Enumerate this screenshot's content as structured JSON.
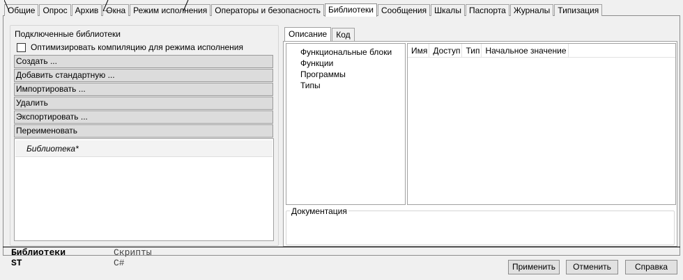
{
  "top_tabs": [
    "Общие",
    "Опрос",
    "Архив",
    "Окна",
    "Режим исполнения",
    "Операторы и безопасность",
    "Библиотеки",
    "Сообщения",
    "Шкалы",
    "Паспорта",
    "Журналы",
    "Типизация"
  ],
  "active_top_tab": "Библиотеки",
  "libraries": {
    "group_title": "Подключенные библиотеки",
    "optimize_label": "Оптимизировать компиляцию для режима исполнения",
    "optimize_checked": false,
    "buttons": [
      "Создать ...",
      "Добавить стандартную ...",
      "Импортировать ...",
      "Удалить",
      "Экспортировать ...",
      "Переименовать"
    ],
    "items": [
      "Библиотека*"
    ]
  },
  "right": {
    "tabs": [
      "Описание",
      "Код"
    ],
    "active_tab": "Описание",
    "tree": [
      "Функциональные блоки",
      "Функции",
      "Программы",
      "Типы"
    ],
    "columns": [
      "Имя",
      "Доступ",
      "Тип",
      "Начальное значение"
    ],
    "doc_title": "Документация"
  },
  "bottom_tabs": [
    "Библиотеки ST",
    "Скрипты C#"
  ],
  "actions": {
    "apply": "Применить",
    "cancel": "Отменить",
    "help": "Справка"
  }
}
